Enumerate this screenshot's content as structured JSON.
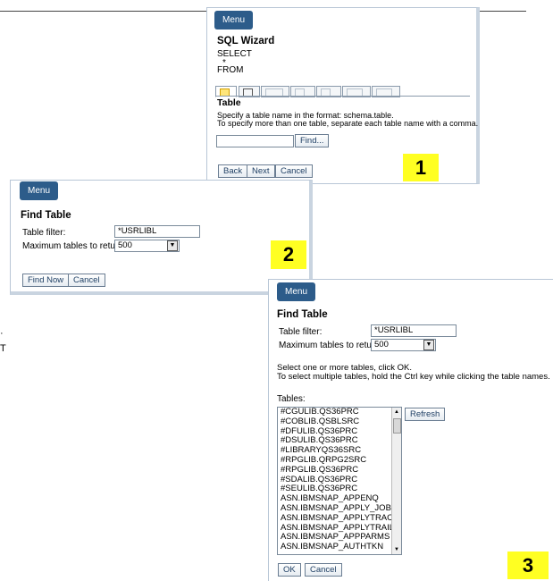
{
  "panel1": {
    "menu": "Menu",
    "title": "SQL Wizard",
    "sql": [
      "SELECT",
      "*",
      "FROM"
    ],
    "section_title": "Table",
    "instructions": [
      "Specify a table name in the format: schema.table.",
      "To specify more than one table, separate each table name with a comma."
    ],
    "table_value": "",
    "find": "Find...",
    "buttons": {
      "back": "Back",
      "next": "Next",
      "cancel": "Cancel"
    },
    "badge": "1"
  },
  "panel2": {
    "menu": "Menu",
    "title": "Find Table",
    "filter_label": "Table filter:",
    "filter_value": "*USRLIBL",
    "max_label": "Maximum tables to return:",
    "max_value": "500",
    "buttons": {
      "find_now": "Find Now",
      "cancel": "Cancel"
    },
    "badge": "2"
  },
  "panel3": {
    "menu": "Menu",
    "title": "Find Table",
    "filter_label": "Table filter:",
    "filter_value": "*USRLIBL",
    "max_label": "Maximum tables to return:",
    "max_value": "500",
    "instructions": [
      "Select one or more tables, click OK.",
      "To select multiple tables, hold the Ctrl key while clicking the table names."
    ],
    "tables_label": "Tables:",
    "tables": [
      "#CGULIB.QS36PRC",
      "#COBLIB.QSBLSRC",
      "#DFULIB.QS36PRC",
      "#DSULIB.QS36PRC",
      "#LIBRARYQS36SRC",
      "#RPGLIB.QRPG2SRC",
      "#RPGLIB.QS36PRC",
      "#SDALIB.QS36PRC",
      "#SEULIB.QS36PRC",
      "ASN.IBMSNAP_APPENQ",
      "ASN.IBMSNAP_APPLY_JOB",
      "ASN.IBMSNAP_APPLYTRACE",
      "ASN.IBMSNAP_APPLYTRAIL",
      "ASN.IBMSNAP_APPPARMS",
      "ASN.IBMSNAP_AUTHTKN"
    ],
    "refresh": "Refresh",
    "buttons": {
      "ok": "OK",
      "cancel": "Cancel"
    },
    "badge": "3"
  },
  "fragments": {
    "a": "·",
    "b": "T"
  }
}
